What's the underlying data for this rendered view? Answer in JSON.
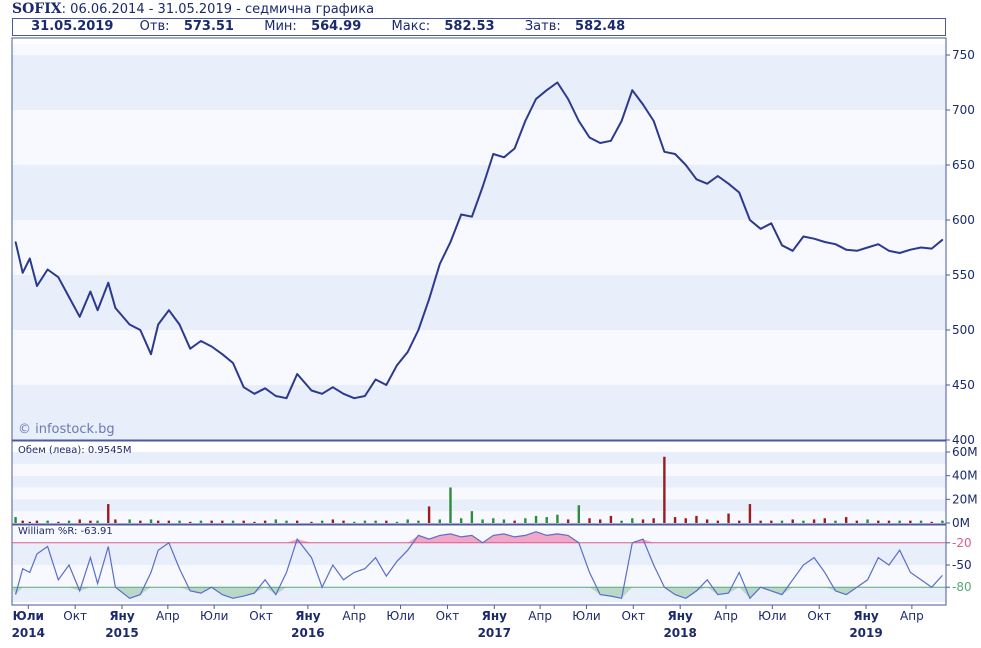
{
  "header": {
    "symbol": "SOFIX",
    "range_text": ": 06.06.2014 - 31.05.2019 - седмична графика"
  },
  "stats": {
    "date": "31.05.2019",
    "open_label": "Отв:",
    "open": "573.51",
    "min_label": "Мин:",
    "min": "564.99",
    "max_label": "Макс:",
    "max": "582.53",
    "close_label": "Затв:",
    "close": "582.48"
  },
  "watermark": "© infostock.bg",
  "volume_label": "Обем (лева): 0.9545M",
  "williams_label": "William %R: -63.91",
  "colors": {
    "price_line": "#2b3a8f",
    "band_light": "#e9eefb",
    "band_white": "#f7f9ff",
    "vol_up": "#2e8b3a",
    "vol_down": "#9b1c1c",
    "wr_line": "#5b6ec4",
    "wr_over": "#f2a6c8",
    "wr_under": "#b9d8c8",
    "line_20": "#e05a8a",
    "line_80": "#5aa87a"
  },
  "chart_data": [
    {
      "type": "line",
      "title": "SOFIX",
      "ylim": [
        400,
        760
      ],
      "y_ticks": [
        "750",
        "700",
        "650",
        "600",
        "550",
        "500",
        "450",
        "400"
      ],
      "y_tick_values": [
        750,
        700,
        650,
        600,
        550,
        500,
        450,
        400
      ],
      "x": [
        "2014-06-06",
        "2014-06-20",
        "2014-07-04",
        "2014-07-18",
        "2014-08-08",
        "2014-08-29",
        "2014-09-19",
        "2014-10-10",
        "2014-10-31",
        "2014-11-14",
        "2014-12-05",
        "2014-12-19",
        "2015-01-16",
        "2015-02-06",
        "2015-02-27",
        "2015-03-13",
        "2015-04-03",
        "2015-04-24",
        "2015-05-15",
        "2015-06-05",
        "2015-06-26",
        "2015-07-17",
        "2015-08-07",
        "2015-08-28",
        "2015-09-18",
        "2015-10-09",
        "2015-10-30",
        "2015-11-20",
        "2015-12-11",
        "2016-01-08",
        "2016-01-29",
        "2016-02-19",
        "2016-03-11",
        "2016-04-01",
        "2016-04-22",
        "2016-05-13",
        "2016-06-03",
        "2016-06-24",
        "2016-07-15",
        "2016-08-05",
        "2016-08-26",
        "2016-09-16",
        "2016-10-07",
        "2016-10-28",
        "2016-11-18",
        "2016-12-09",
        "2016-12-30",
        "2017-01-20",
        "2017-02-10",
        "2017-03-03",
        "2017-03-24",
        "2017-04-14",
        "2017-05-05",
        "2017-05-26",
        "2017-06-16",
        "2017-07-07",
        "2017-07-28",
        "2017-08-18",
        "2017-09-08",
        "2017-09-29",
        "2017-10-20",
        "2017-11-10",
        "2017-12-01",
        "2017-12-22",
        "2018-01-12",
        "2018-02-02",
        "2018-02-23",
        "2018-03-16",
        "2018-04-06",
        "2018-04-27",
        "2018-05-18",
        "2018-06-08",
        "2018-06-29",
        "2018-07-20",
        "2018-08-10",
        "2018-08-31",
        "2018-09-21",
        "2018-10-12",
        "2018-11-02",
        "2018-11-23",
        "2018-12-14",
        "2019-01-04",
        "2019-01-25",
        "2019-02-15",
        "2019-03-08",
        "2019-03-29",
        "2019-04-19",
        "2019-05-10",
        "2019-05-31"
      ],
      "series": [
        {
          "values": [
            580,
            552,
            565,
            540,
            555,
            548,
            530,
            512,
            535,
            518,
            543,
            520,
            505,
            500,
            478,
            505,
            518,
            505,
            483,
            490,
            485,
            478,
            470,
            448,
            442,
            447,
            440,
            438,
            460,
            445,
            442,
            448,
            442,
            438,
            440,
            455,
            450,
            468,
            480,
            500,
            528,
            560,
            580,
            605,
            603,
            630,
            660,
            657,
            665,
            690,
            710,
            718,
            725,
            710,
            690,
            675,
            670,
            672,
            690,
            718,
            705,
            690,
            662,
            660,
            650,
            637,
            633,
            640,
            633,
            625,
            600,
            592,
            597,
            577,
            572,
            585,
            583,
            580,
            578,
            573,
            572,
            575,
            578,
            572,
            570,
            573,
            575,
            574,
            582
          ],
          "color": "#2b3a8f"
        }
      ]
    },
    {
      "type": "bar",
      "ylim": [
        0,
        60
      ],
      "y_ticks": [
        "60M",
        "40M",
        "20M",
        "0M"
      ],
      "y_tick_values": [
        60,
        40,
        20,
        0
      ],
      "x": [
        "2014-06-06",
        "2014-06-20",
        "2014-07-04",
        "2014-07-18",
        "2014-08-08",
        "2014-08-29",
        "2014-09-19",
        "2014-10-10",
        "2014-10-31",
        "2014-11-14",
        "2014-12-05",
        "2014-12-19",
        "2015-01-16",
        "2015-02-06",
        "2015-02-27",
        "2015-03-13",
        "2015-04-03",
        "2015-04-24",
        "2015-05-15",
        "2015-06-05",
        "2015-06-26",
        "2015-07-17",
        "2015-08-07",
        "2015-08-28",
        "2015-09-18",
        "2015-10-09",
        "2015-10-30",
        "2015-11-20",
        "2015-12-11",
        "2016-01-08",
        "2016-01-29",
        "2016-02-19",
        "2016-03-11",
        "2016-04-01",
        "2016-04-22",
        "2016-05-13",
        "2016-06-03",
        "2016-06-24",
        "2016-07-15",
        "2016-08-05",
        "2016-08-26",
        "2016-09-16",
        "2016-10-07",
        "2016-10-28",
        "2016-11-18",
        "2016-12-09",
        "2016-12-30",
        "2017-01-20",
        "2017-02-10",
        "2017-03-03",
        "2017-03-24",
        "2017-04-14",
        "2017-05-05",
        "2017-05-26",
        "2017-06-16",
        "2017-07-07",
        "2017-07-28",
        "2017-08-18",
        "2017-09-08",
        "2017-09-29",
        "2017-10-20",
        "2017-11-10",
        "2017-12-01",
        "2017-12-22",
        "2018-01-12",
        "2018-02-02",
        "2018-02-23",
        "2018-03-16",
        "2018-04-06",
        "2018-04-27",
        "2018-05-18",
        "2018-06-08",
        "2018-06-29",
        "2018-07-20",
        "2018-08-10",
        "2018-08-31",
        "2018-09-21",
        "2018-10-12",
        "2018-11-02",
        "2018-11-23",
        "2018-12-14",
        "2019-01-04",
        "2019-01-25",
        "2019-02-15",
        "2019-03-08",
        "2019-03-29",
        "2019-04-19",
        "2019-05-10",
        "2019-05-31"
      ],
      "series": [
        {
          "values": [
            5,
            2,
            1,
            2,
            2,
            1,
            2,
            3,
            2,
            2,
            16,
            3,
            3,
            2,
            3,
            2,
            2,
            2,
            1,
            2,
            2,
            2,
            2,
            2,
            1,
            2,
            3,
            2,
            2,
            1,
            2,
            3,
            2,
            1,
            2,
            2,
            2,
            1,
            3,
            2,
            14,
            3,
            30,
            4,
            10,
            3,
            4,
            3,
            2,
            4,
            6,
            5,
            7,
            3,
            15,
            4,
            3,
            6,
            2,
            4,
            3,
            4,
            56,
            5,
            4,
            6,
            3,
            2,
            8,
            2,
            16,
            2,
            2,
            2,
            3,
            2,
            3,
            4,
            2,
            5,
            2,
            3,
            2,
            2,
            2,
            2,
            2,
            1,
            2
          ],
          "up": [
            true,
            false,
            false,
            false,
            true,
            false,
            true,
            false,
            false,
            true,
            false,
            false,
            true,
            false,
            true,
            false,
            false,
            true,
            false,
            true,
            false,
            false,
            true,
            false,
            false,
            false,
            true,
            true,
            false,
            false,
            true,
            false,
            false,
            true,
            true,
            true,
            false,
            true,
            true,
            true,
            false,
            true,
            true,
            true,
            true,
            true,
            true,
            true,
            false,
            true,
            true,
            true,
            true,
            false,
            true,
            false,
            false,
            false,
            true,
            true,
            false,
            false,
            false,
            false,
            false,
            false,
            false,
            false,
            false,
            false,
            false,
            false,
            false,
            true,
            false,
            true,
            false,
            false,
            true,
            false,
            false,
            true,
            false,
            false,
            true,
            false,
            true,
            false,
            true
          ]
        }
      ]
    },
    {
      "type": "line",
      "title": "William %R",
      "ylim": [
        -100,
        0
      ],
      "y_ticks": [
        "-20",
        "-50",
        "-80"
      ],
      "y_tick_values": [
        -20,
        -50,
        -80
      ],
      "x": [
        "2014-06-06",
        "2014-06-20",
        "2014-07-04",
        "2014-07-18",
        "2014-08-08",
        "2014-08-29",
        "2014-09-19",
        "2014-10-10",
        "2014-10-31",
        "2014-11-14",
        "2014-12-05",
        "2014-12-19",
        "2015-01-16",
        "2015-02-06",
        "2015-02-27",
        "2015-03-13",
        "2015-04-03",
        "2015-04-24",
        "2015-05-15",
        "2015-06-05",
        "2015-06-26",
        "2015-07-17",
        "2015-08-07",
        "2015-08-28",
        "2015-09-18",
        "2015-10-09",
        "2015-10-30",
        "2015-11-20",
        "2015-12-11",
        "2016-01-08",
        "2016-01-29",
        "2016-02-19",
        "2016-03-11",
        "2016-04-01",
        "2016-04-22",
        "2016-05-13",
        "2016-06-03",
        "2016-06-24",
        "2016-07-15",
        "2016-08-05",
        "2016-08-26",
        "2016-09-16",
        "2016-10-07",
        "2016-10-28",
        "2016-11-18",
        "2016-12-09",
        "2016-12-30",
        "2017-01-20",
        "2017-02-10",
        "2017-03-03",
        "2017-03-24",
        "2017-04-14",
        "2017-05-05",
        "2017-05-26",
        "2017-06-16",
        "2017-07-07",
        "2017-07-28",
        "2017-08-18",
        "2017-09-08",
        "2017-09-29",
        "2017-10-20",
        "2017-11-10",
        "2017-12-01",
        "2017-12-22",
        "2018-01-12",
        "2018-02-02",
        "2018-02-23",
        "2018-03-16",
        "2018-04-06",
        "2018-04-27",
        "2018-05-18",
        "2018-06-08",
        "2018-06-29",
        "2018-07-20",
        "2018-08-10",
        "2018-08-31",
        "2018-09-21",
        "2018-10-12",
        "2018-11-02",
        "2018-11-23",
        "2018-12-14",
        "2019-01-04",
        "2019-01-25",
        "2019-02-15",
        "2019-03-08",
        "2019-03-29",
        "2019-04-19",
        "2019-05-10",
        "2019-05-31"
      ],
      "series": [
        {
          "values": [
            -90,
            -55,
            -60,
            -35,
            -25,
            -70,
            -50,
            -85,
            -40,
            -75,
            -25,
            -80,
            -95,
            -90,
            -60,
            -30,
            -20,
            -55,
            -85,
            -88,
            -80,
            -90,
            -95,
            -92,
            -88,
            -70,
            -90,
            -60,
            -15,
            -40,
            -80,
            -50,
            -70,
            -60,
            -55,
            -40,
            -65,
            -45,
            -30,
            -10,
            -15,
            -10,
            -8,
            -12,
            -10,
            -20,
            -10,
            -8,
            -12,
            -10,
            -5,
            -10,
            -8,
            -10,
            -20,
            -60,
            -90,
            -92,
            -95,
            -20,
            -15,
            -50,
            -80,
            -90,
            -95,
            -85,
            -70,
            -90,
            -88,
            -60,
            -95,
            -80,
            -85,
            -90,
            -70,
            -50,
            -40,
            -60,
            -85,
            -90,
            -80,
            -70,
            -40,
            -50,
            -30,
            -60,
            -70,
            -80,
            -64
          ],
          "color": "#5b6ec4"
        }
      ],
      "reference_lines": [
        -20,
        -80
      ]
    }
  ],
  "x_axis": {
    "labels": [
      {
        "month": "Юли",
        "year": "2014",
        "bold": true,
        "date": "2014-07-01"
      },
      {
        "month": "Окт",
        "year": "",
        "bold": false,
        "date": "2014-10-01"
      },
      {
        "month": "Яну",
        "year": "2015",
        "bold": true,
        "date": "2015-01-01"
      },
      {
        "month": "Апр",
        "year": "",
        "bold": false,
        "date": "2015-04-01"
      },
      {
        "month": "Юли",
        "year": "",
        "bold": false,
        "date": "2015-07-01"
      },
      {
        "month": "Окт",
        "year": "",
        "bold": false,
        "date": "2015-10-01"
      },
      {
        "month": "Яну",
        "year": "2016",
        "bold": true,
        "date": "2016-01-01"
      },
      {
        "month": "Апр",
        "year": "",
        "bold": false,
        "date": "2016-04-01"
      },
      {
        "month": "Юли",
        "year": "",
        "bold": false,
        "date": "2016-07-01"
      },
      {
        "month": "Окт",
        "year": "",
        "bold": false,
        "date": "2016-10-01"
      },
      {
        "month": "Яну",
        "year": "2017",
        "bold": true,
        "date": "2017-01-01"
      },
      {
        "month": "Апр",
        "year": "",
        "bold": false,
        "date": "2017-04-01"
      },
      {
        "month": "Юли",
        "year": "",
        "bold": false,
        "date": "2017-07-01"
      },
      {
        "month": "Окт",
        "year": "",
        "bold": false,
        "date": "2017-10-01"
      },
      {
        "month": "Яну",
        "year": "2018",
        "bold": true,
        "date": "2018-01-01"
      },
      {
        "month": "Апр",
        "year": "",
        "bold": false,
        "date": "2018-04-01"
      },
      {
        "month": "Юли",
        "year": "",
        "bold": false,
        "date": "2018-07-01"
      },
      {
        "month": "Окт",
        "year": "",
        "bold": false,
        "date": "2018-10-01"
      },
      {
        "month": "Яну",
        "year": "2019",
        "bold": true,
        "date": "2019-01-01"
      },
      {
        "month": "Апр",
        "year": "",
        "bold": false,
        "date": "2019-04-01"
      }
    ]
  }
}
